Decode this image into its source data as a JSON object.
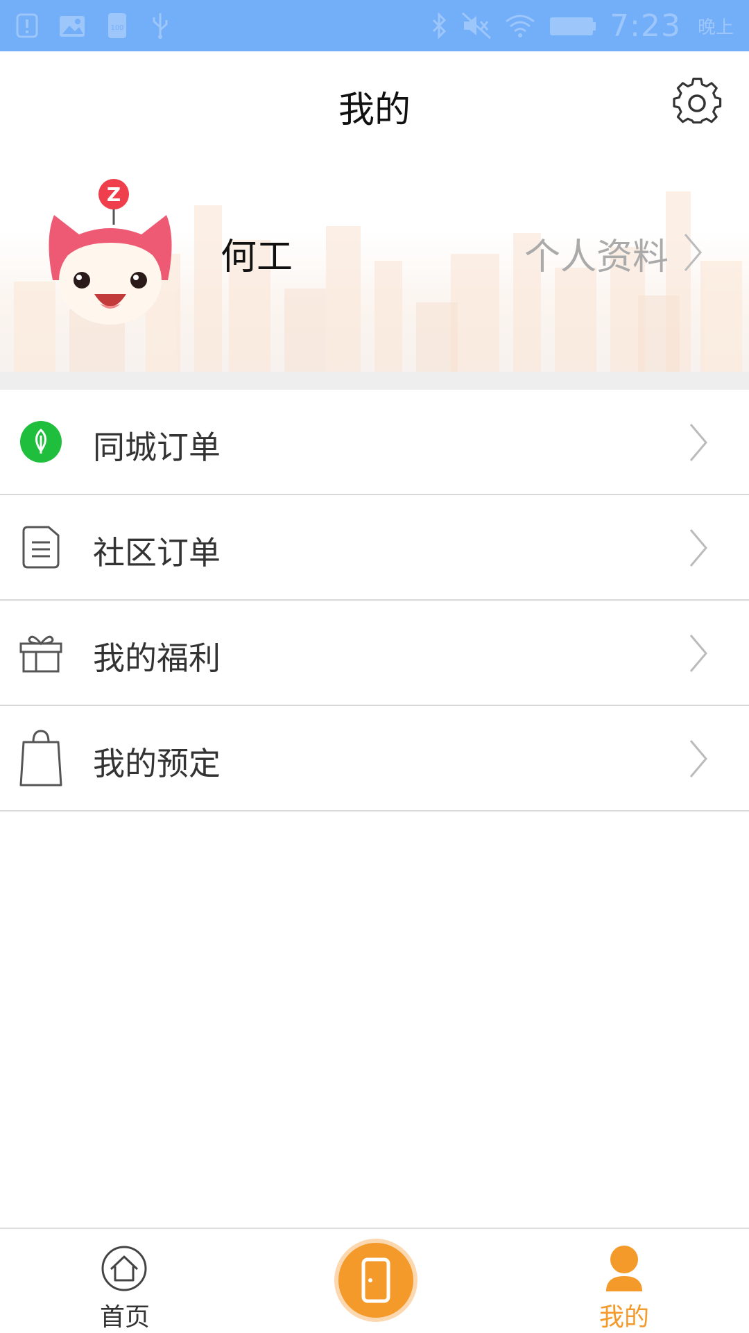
{
  "status_bar": {
    "time": "7:23",
    "ampm": "晚上"
  },
  "header": {
    "title": "我的"
  },
  "profile": {
    "username": "何工",
    "link_label": "个人资料"
  },
  "menu": {
    "items": [
      {
        "label": "同城订单",
        "icon": "leaf-icon"
      },
      {
        "label": "社区订单",
        "icon": "document-icon"
      },
      {
        "label": "我的福利",
        "icon": "gift-icon"
      },
      {
        "label": "我的预定",
        "icon": "shopping-bag-icon"
      }
    ]
  },
  "bottom_nav": {
    "home_label": "首页",
    "center_icon": "door-icon",
    "mine_label": "我的"
  },
  "colors": {
    "status_bar": "#73aef9",
    "accent_orange": "#f39a2b",
    "leaf_green": "#1fbe3c",
    "divider": "#eeeeee"
  }
}
